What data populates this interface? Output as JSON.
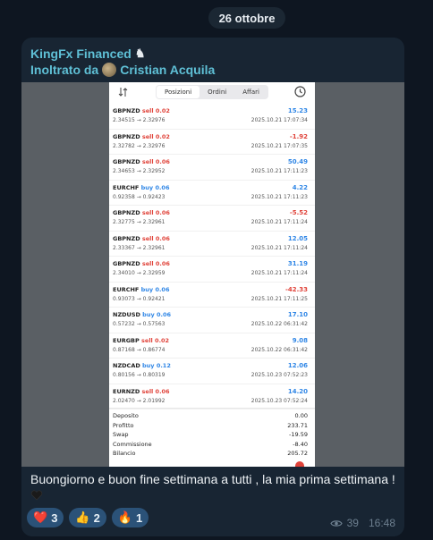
{
  "date_label": "26 ottobre",
  "message": {
    "channel_name": "KingFx Financed",
    "channel_icon": "knight-chess-icon",
    "forwarded_prefix": "Inoltrato da",
    "forwarded_from": "Cristian Acquila",
    "caption": "Buongiorno e buon fine settimana a tutti , la mia prima settimana !",
    "reactions": [
      {
        "emoji": "❤️",
        "count": "3"
      },
      {
        "emoji": "👍",
        "count": "2"
      },
      {
        "emoji": "🔥",
        "count": "1"
      }
    ],
    "views": "39",
    "time": "16:48"
  },
  "screenshot": {
    "tabs": [
      "Posizioni",
      "Ordini",
      "Affari"
    ],
    "active_tab": "Posizioni",
    "trades": [
      {
        "symbol": "GBPNZD",
        "side": "sell",
        "lot": "0.02",
        "prices": "2.34515 → 2.32976",
        "profit": "15.23",
        "date": "2025.10.21 17:07:34"
      },
      {
        "symbol": "GBPNZD",
        "side": "sell",
        "lot": "0.02",
        "prices": "2.32782 → 2.32976",
        "profit": "-1.92",
        "date": "2025.10.21 17:07:35"
      },
      {
        "symbol": "GBPNZD",
        "side": "sell",
        "lot": "0.06",
        "prices": "2.34653 → 2.32952",
        "profit": "50.49",
        "date": "2025.10.21 17:11:23"
      },
      {
        "symbol": "EURCHF",
        "side": "buy",
        "lot": "0.06",
        "prices": "0.92358 → 0.92423",
        "profit": "4.22",
        "date": "2025.10.21 17:11:23"
      },
      {
        "symbol": "GBPNZD",
        "side": "sell",
        "lot": "0.06",
        "prices": "2.32775 → 2.32961",
        "profit": "-5.52",
        "date": "2025.10.21 17:11:24"
      },
      {
        "symbol": "GBPNZD",
        "side": "sell",
        "lot": "0.06",
        "prices": "2.33367 → 2.32961",
        "profit": "12.05",
        "date": "2025.10.21 17:11:24"
      },
      {
        "symbol": "GBPNZD",
        "side": "sell",
        "lot": "0.06",
        "prices": "2.34010 → 2.32959",
        "profit": "31.19",
        "date": "2025.10.21 17:11:24"
      },
      {
        "symbol": "EURCHF",
        "side": "buy",
        "lot": "0.06",
        "prices": "0.93073 → 0.92421",
        "profit": "-42.33",
        "date": "2025.10.21 17:11:25"
      },
      {
        "symbol": "NZDUSD",
        "side": "buy",
        "lot": "0.06",
        "prices": "0.57232 → 0.57563",
        "profit": "17.10",
        "date": "2025.10.22 06:31:42"
      },
      {
        "symbol": "EURGBP",
        "side": "sell",
        "lot": "0.02",
        "prices": "0.87168 → 0.86774",
        "profit": "9.08",
        "date": "2025.10.22 06:31:42"
      },
      {
        "symbol": "NZDCAD",
        "side": "buy",
        "lot": "0.12",
        "prices": "0.80156 → 0.80319",
        "profit": "12.06",
        "date": "2025.10.23 07:52:23"
      },
      {
        "symbol": "EURNZD",
        "side": "sell",
        "lot": "0.06",
        "prices": "2.02470 → 2.01992",
        "profit": "14.20",
        "date": "2025.10.23 07:52:24"
      }
    ],
    "summary": [
      {
        "label": "Deposito",
        "value": "0.00"
      },
      {
        "label": "Profitto",
        "value": "233.71"
      },
      {
        "label": "Swap",
        "value": "-19.59"
      },
      {
        "label": "Commissione",
        "value": "-8.40"
      },
      {
        "label": "Bilancio",
        "value": "205.72"
      }
    ]
  }
}
